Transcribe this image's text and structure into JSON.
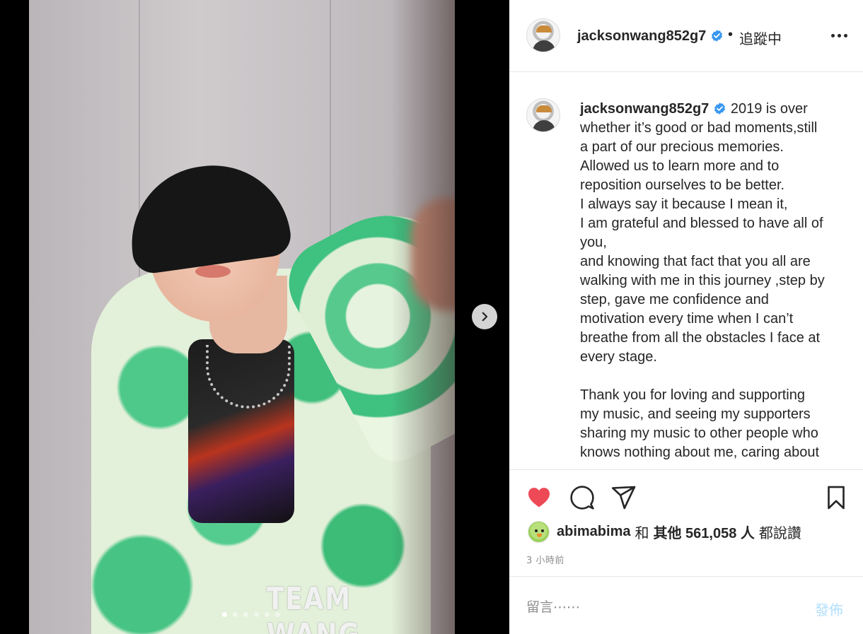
{
  "media": {
    "photo_overlay_text": "TEAM WANG",
    "carousel_total": 6,
    "carousel_active_index": 0
  },
  "header": {
    "username": "jacksonwang852g7",
    "separator": "•",
    "follow_status": "追蹤中"
  },
  "caption": {
    "username": "jacksonwang852g7",
    "text": " 2019 is over\nwhether it’s good or bad moments,still\na part of our precious memories.\nAllowed us to learn more and to\nreposition ourselves to be better.\nI always say it because I mean it,\nI am grateful and blessed to have all of\nyou,\nand knowing that fact that you all are\nwalking with me in this journey ,step by\nstep, gave me confidence and\nmotivation every time when I can’t\nbreathe from all the obstacles I face at\nevery stage.\n\nThank you for loving and supporting\nmy music, and seeing my supporters\nsharing my music to other people who\nknows nothing about me, caring about"
  },
  "actions": {
    "liked": true,
    "icons": [
      "heart-icon",
      "comment-icon",
      "share-icon",
      "bookmark-icon"
    ]
  },
  "likes": {
    "user": "abimabima",
    "conj": "和",
    "others_label": "其他 561,058 人",
    "suffix": "都說讚"
  },
  "time_ago": "3 小時前",
  "comment": {
    "placeholder": "留言⋯⋯",
    "post_label": "發佈"
  },
  "colors": {
    "like_red": "#ed4956",
    "verified_blue": "#3897f0",
    "post_disabled": "#b2dffc"
  }
}
